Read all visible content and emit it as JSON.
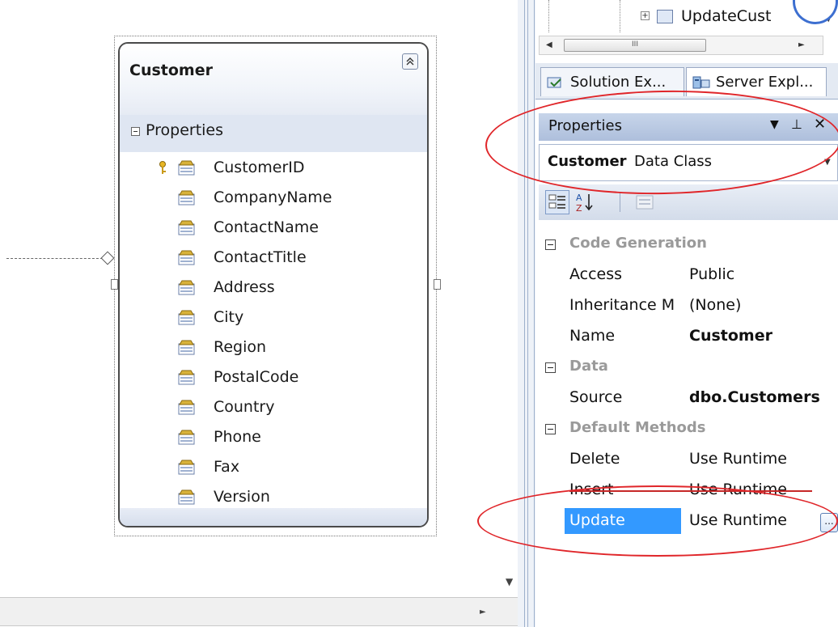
{
  "entity": {
    "title": "Customer",
    "section_label": "Properties",
    "properties": [
      {
        "name": "CustomerID",
        "is_key": true
      },
      {
        "name": "CompanyName",
        "is_key": false
      },
      {
        "name": "ContactName",
        "is_key": false
      },
      {
        "name": "ContactTitle",
        "is_key": false
      },
      {
        "name": "Address",
        "is_key": false
      },
      {
        "name": "City",
        "is_key": false
      },
      {
        "name": "Region",
        "is_key": false
      },
      {
        "name": "PostalCode",
        "is_key": false
      },
      {
        "name": "Country",
        "is_key": false
      },
      {
        "name": "Phone",
        "is_key": false
      },
      {
        "name": "Fax",
        "is_key": false
      },
      {
        "name": "Version",
        "is_key": false
      }
    ]
  },
  "solution_tree": {
    "node_label": "UpdateCust",
    "expander": "+",
    "scroll_thumb": "III"
  },
  "tabs": [
    {
      "label": "Solution Ex...",
      "icon": "solution-explorer-icon"
    },
    {
      "label": "Server Expl...",
      "icon": "server-explorer-icon"
    }
  ],
  "properties_window": {
    "title": "Properties",
    "object_name": "Customer",
    "object_type": "Data Class",
    "categories": [
      {
        "label": "Code Generation",
        "rows": [
          {
            "name": "Access",
            "value": "Public",
            "bold": false
          },
          {
            "name": "Inheritance M",
            "value": "(None)",
            "bold": false
          },
          {
            "name": "Name",
            "value": "Customer",
            "bold": true
          }
        ]
      },
      {
        "label": "Data",
        "rows": [
          {
            "name": "Source",
            "value": "dbo.Customers",
            "bold": true
          }
        ]
      },
      {
        "label": "Default Methods",
        "rows": [
          {
            "name": "Delete",
            "value": "Use Runtime",
            "bold": false
          },
          {
            "name": "Insert",
            "value": "Use Runtime",
            "bold": false
          },
          {
            "name": "Update",
            "value": "Use Runtime",
            "bold": false,
            "selected": true
          }
        ]
      }
    ],
    "ellipsis_label": "..."
  },
  "colors": {
    "annotation": "#e0262a",
    "selection": "#3399ff",
    "accent_blue": "#3d6fd0"
  }
}
